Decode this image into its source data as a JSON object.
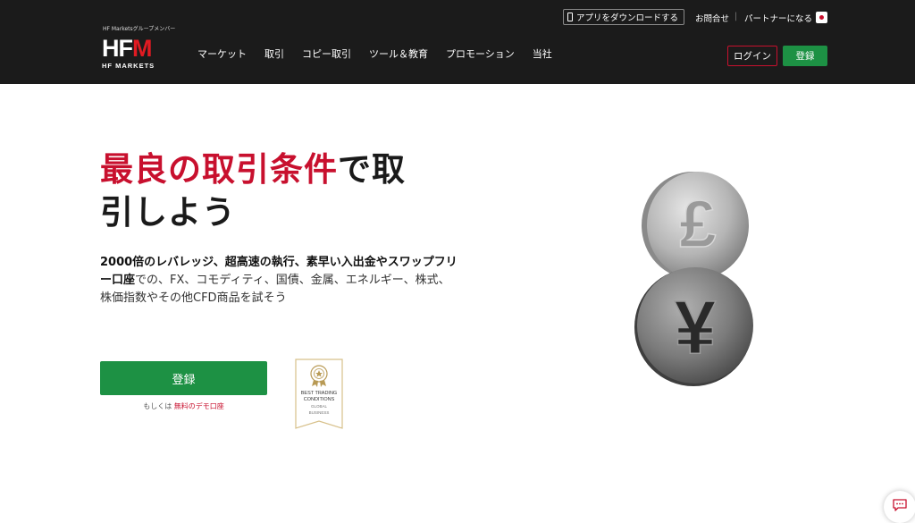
{
  "header": {
    "app_download": "アプリをダウンロードする",
    "contact": "お問合せ",
    "separator": "|",
    "partner": "パートナーになる",
    "group_member": "HF Marketsグループメンバー",
    "logo_main_hf": "HF",
    "logo_main_m": "M",
    "logo_sub": "HF MARKETS",
    "nav": [
      "マーケット",
      "取引",
      "コピー取引",
      "ツール＆教育",
      "プロモーション",
      "当社"
    ],
    "login": "ログイン",
    "register": "登録"
  },
  "hero": {
    "title_red": "最良の取引条件",
    "title_rest_1": "で取",
    "title_rest_2": "引しよう",
    "desc_bold": "2000倍のレバレッジ、超高速の執行、素早い入出金やスワップフリー口座",
    "desc_rest": "での、FX、コモディティ、国債、金属、エネルギー、株式、株価指数やその他CFD商品を試そう",
    "cta": "登録",
    "demo_prefix": "もしくは",
    "demo_link": "無料のデモ口座"
  },
  "award": {
    "line1": "BEST TRADING",
    "line2": "CONDITIONS",
    "line3": "GLOBAL",
    "line4": "BUSINESS"
  },
  "coins": {
    "top_symbol": "£",
    "bottom_symbol": "¥"
  },
  "colors": {
    "header_bg": "#1b1b1b",
    "brand_red": "#c8102e",
    "brand_green": "#1d9144"
  }
}
